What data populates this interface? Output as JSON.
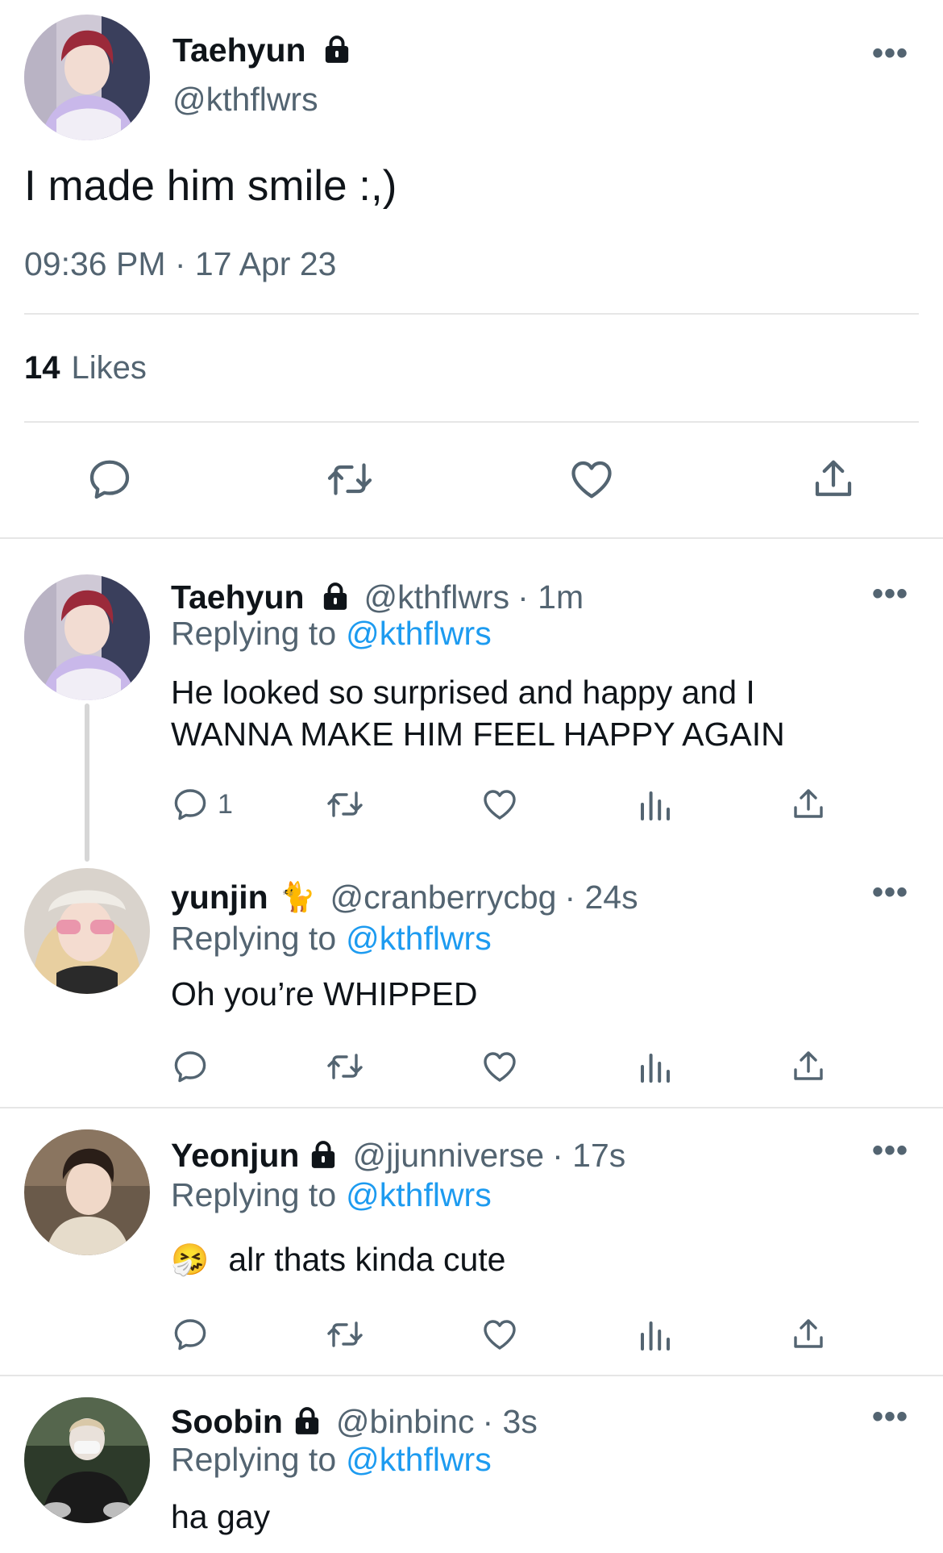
{
  "main_tweet": {
    "author_name": "Taehyun",
    "handle": "@kthflwrs",
    "text": "I made him smile :,)",
    "timestamp": "09:36 PM · 17 Apr 23",
    "likes_count": "14",
    "likes_label": "Likes"
  },
  "replies": [
    {
      "author_name": "Taehyun",
      "handle": "@kthflwrs",
      "time": "· 1m",
      "replying_prefix": "Replying to",
      "replying_to": "@kthflwrs",
      "text_line1": "He looked so surprised and happy and I",
      "text_line2": "WANNA MAKE HIM FEEL HAPPY AGAIN",
      "reply_count": "1"
    },
    {
      "author_name": "yunjin",
      "name_emoji": "🐈",
      "handle": "@cranberrycbg",
      "time": "· 24s",
      "replying_prefix": "Replying to",
      "replying_to": "@kthflwrs",
      "text": "Oh you’re WHIPPED"
    },
    {
      "author_name": "Yeonjun",
      "handle": "@jjunniverse",
      "time": "· 17s",
      "replying_prefix": "Replying to",
      "replying_to": "@kthflwrs",
      "text_emoji": "🤧",
      "text": "alr thats kinda cute"
    },
    {
      "author_name": "Soobin",
      "handle": "@binbinc",
      "time": "· 3s",
      "replying_prefix": "Replying to",
      "replying_to": "@kthflwrs",
      "text": "ha gay"
    }
  ],
  "more_label": "•••",
  "colors": {
    "link": "#1d9bf0",
    "secondary": "#536471",
    "divider": "#e6e6e6"
  }
}
